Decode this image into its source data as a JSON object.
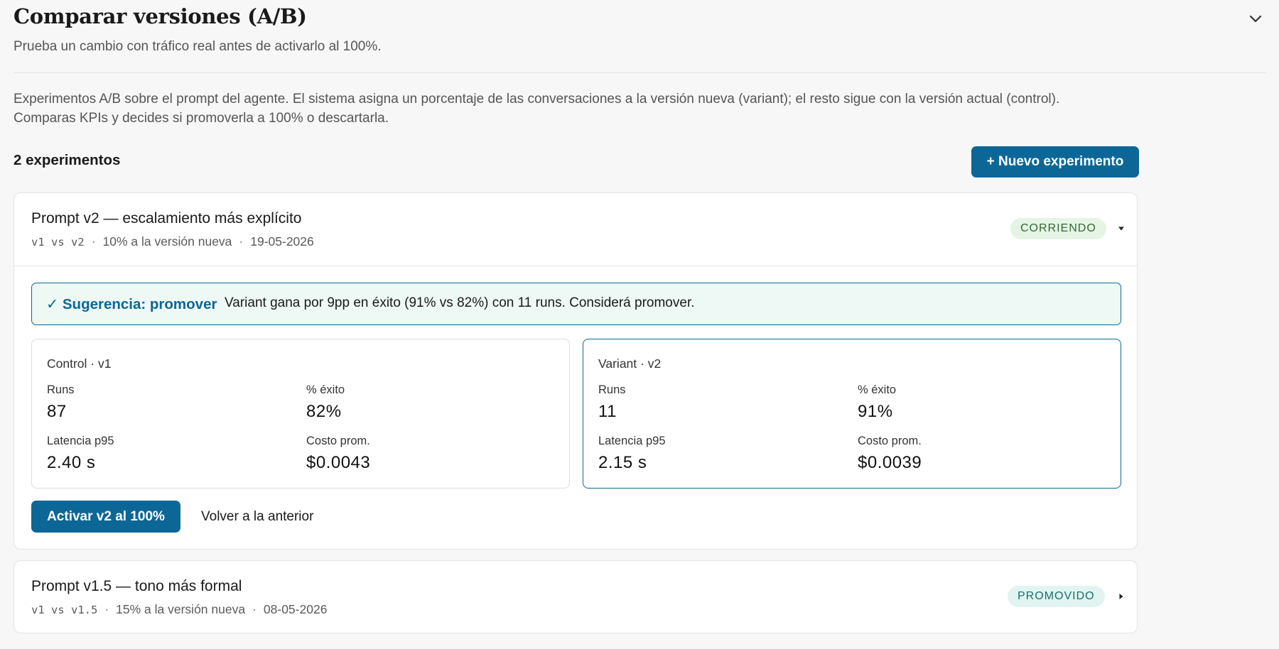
{
  "section": {
    "title": "Comparar versiones (A/B)",
    "subtitle": "Prueba un cambio con tráfico real antes de activarlo al 100%.",
    "collapse_icon": "chevron-down-icon"
  },
  "intro": {
    "line1": "Experimentos A/B sobre el prompt del agente. El sistema asigna un porcentaje de las conversaciones a la versión nueva (variant); el resto sigue con la versión actual (control).",
    "line2": "Comparas KPIs y decides si promoverla a 100% o descartarla."
  },
  "experiments_count": "2 experimentos",
  "new_experiment_label": "+ Nuevo experimento",
  "colors": {
    "primary": "#0d6796",
    "running_badge_bg": "#e6f4e6",
    "running_badge_text": "#2f6b2f",
    "promoted_badge_bg": "#e2f4f1",
    "promoted_badge_text": "#16706b",
    "suggestion_bg": "#eef8f5"
  },
  "experiments": [
    {
      "title": "Prompt v2 — escalamiento más explícito",
      "meta": {
        "versions": "v1 vs v2",
        "split": "10% a la versión nueva",
        "date": "19-05-2026"
      },
      "status": "CORRIENDO",
      "expanded": true,
      "suggestion": {
        "label": "✓ Sugerencia: promover",
        "text": "Variant gana por 9pp en éxito (91% vs 82%) con 11 runs. Considerá promover."
      },
      "control": {
        "heading": "Control · v1",
        "runs_label": "Runs",
        "runs": "87",
        "success_label": "% éxito",
        "success": "82%",
        "latency_label": "Latencia p95",
        "latency": "2.40 s",
        "cost_label": "Costo prom.",
        "cost": "$0.0043"
      },
      "variant": {
        "heading": "Variant · v2",
        "runs_label": "Runs",
        "runs": "11",
        "success_label": "% éxito",
        "success": "91%",
        "latency_label": "Latencia p95",
        "latency": "2.15 s",
        "cost_label": "Costo prom.",
        "cost": "$0.0039"
      },
      "activate_label": "Activar v2 al 100%",
      "revert_label": "Volver a la anterior"
    },
    {
      "title": "Prompt v1.5 — tono más formal",
      "meta": {
        "versions_a": "v1 vs ",
        "versions_b": "v1.5",
        "split": "15% a la versión nueva",
        "date": "08-05-2026"
      },
      "status": "PROMOVIDO",
      "expanded": false
    }
  ]
}
